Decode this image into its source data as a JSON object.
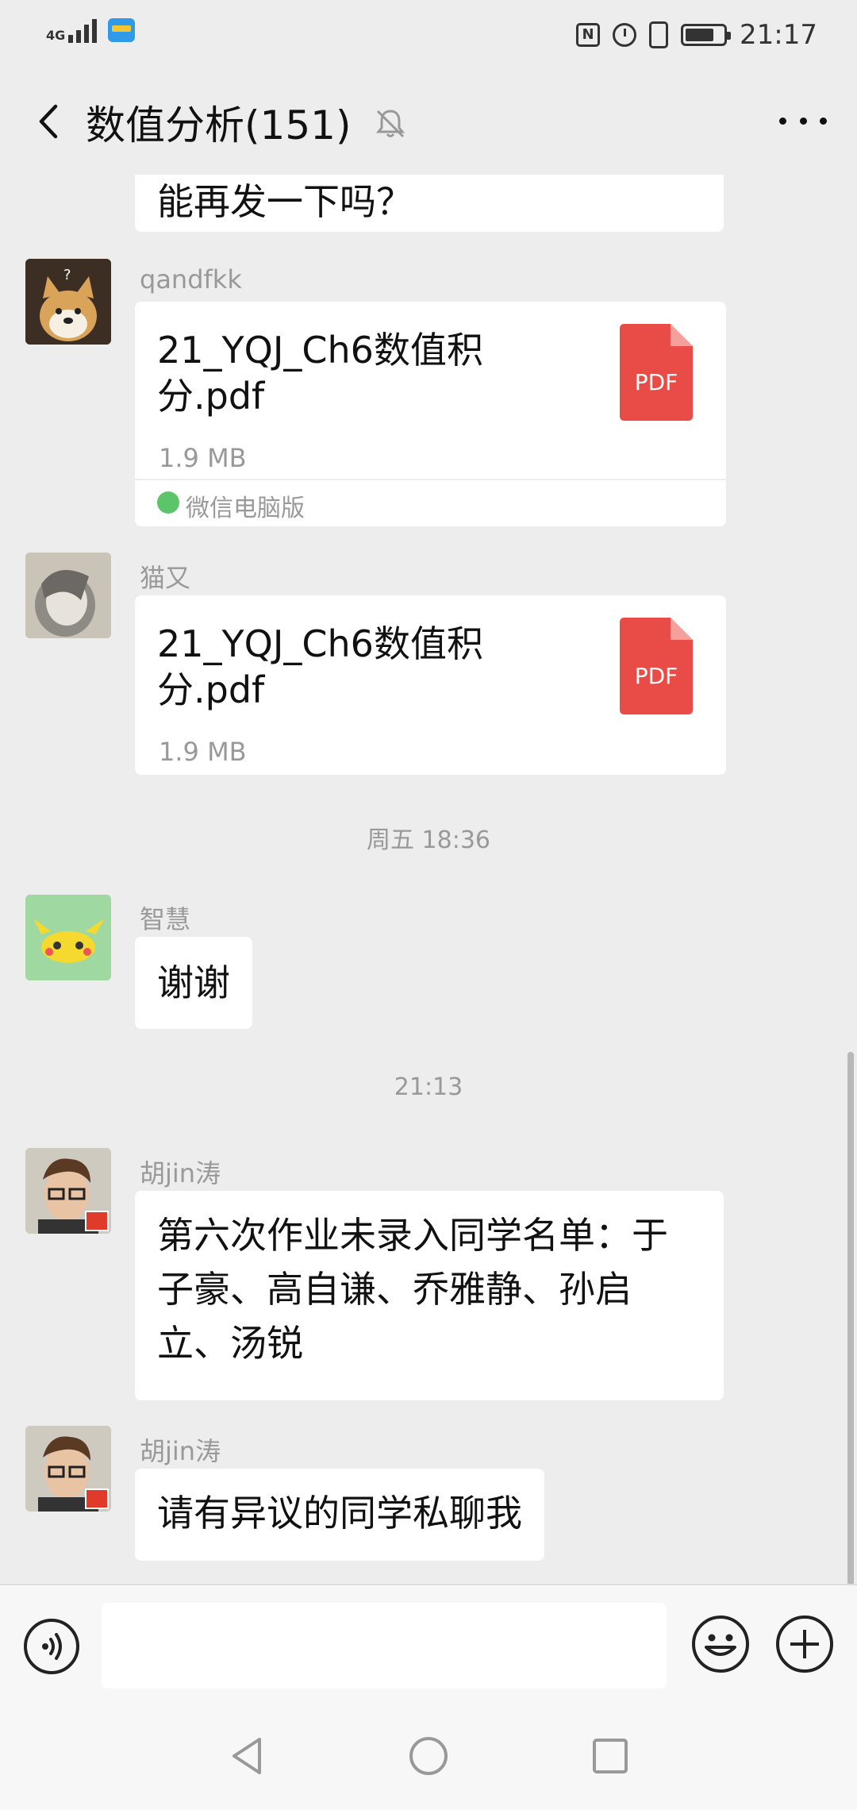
{
  "status_bar": {
    "signal_text": "4G",
    "signal_level": 4,
    "battery_level": 0.75,
    "time": "21:17",
    "icons": [
      "wallet-icon",
      "nfc-icon",
      "alarm-icon",
      "vibrate-icon",
      "battery-icon"
    ]
  },
  "header": {
    "title": "数值分析(151)",
    "icons": [
      "back-icon",
      "mute-bell-icon",
      "more-icon"
    ]
  },
  "messages": [
    {
      "type": "text",
      "text": "能再发一下吗？"
    },
    {
      "type": "file",
      "sender": "qandfkk",
      "file_name": "21_YQJ_Ch6数值积分.pdf",
      "file_size": "1.9 MB",
      "file_badge": "PDF",
      "source": "微信电脑版"
    },
    {
      "type": "file",
      "sender": "猫又",
      "file_name": "21_YQJ_Ch6数值积分.pdf",
      "file_size": "1.9 MB",
      "file_badge": "PDF"
    },
    {
      "type": "timestamp",
      "text": "周五 18:36"
    },
    {
      "type": "text",
      "sender": "智慧",
      "text": "谢谢"
    },
    {
      "type": "timestamp",
      "text": "21:13"
    },
    {
      "type": "text",
      "sender": "胡jin涛",
      "text": "第六次作业未录入同学名单：于子豪、高自谦、乔雅静、孙启立、汤锐"
    },
    {
      "type": "text",
      "sender": "胡jin涛",
      "text": "请有异议的同学私聊我"
    }
  ],
  "input_bar": {
    "placeholder": "",
    "icons": [
      "voice-icon",
      "emoji-icon",
      "plus-icon"
    ]
  },
  "nav_bar": {
    "icons": [
      "nav-back-icon",
      "nav-home-icon",
      "nav-recent-icon"
    ]
  },
  "colors": {
    "background": "#ededed",
    "bubble": "#ffffff",
    "pdf_red": "#e94b47",
    "muted_text": "#999999"
  }
}
